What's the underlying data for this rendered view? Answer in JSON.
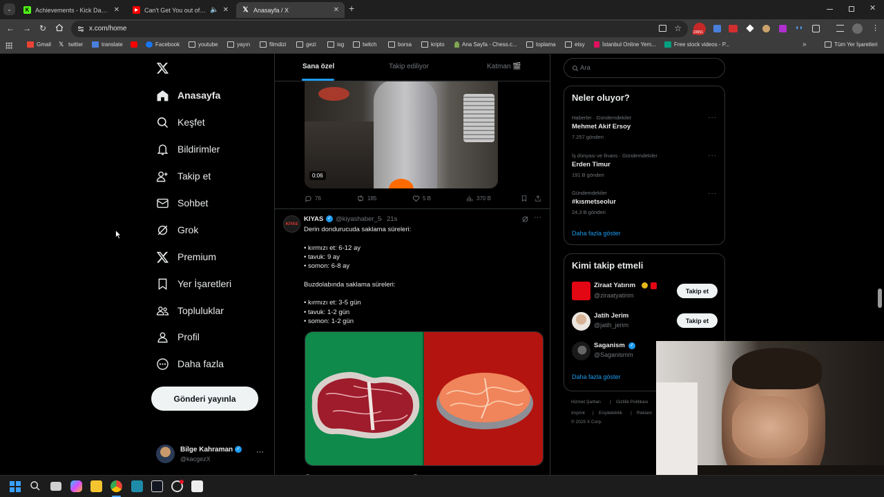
{
  "browser": {
    "tabs": [
      {
        "title": "Achievements - Kick Dashboard",
        "icon": "kick-icon",
        "color": "#53fc18"
      },
      {
        "title": "Can't Get You out of My He",
        "icon": "youtube-icon",
        "color": "#ff0000"
      },
      {
        "title": "Anasayfa / X",
        "icon": "x-logo-icon",
        "color": "#ffffff"
      }
    ],
    "url": "x.com/home",
    "badge_count": "23951",
    "bookmarks": [
      "Gmail",
      "twitter",
      "translate",
      "Facebook",
      "youtube",
      "yayın",
      "filmdizi",
      "gezi",
      "isg",
      "twitch",
      "borsa",
      "kripto",
      "Ana Sayfa - Chess.c...",
      "toplama",
      "etsy",
      "İstanbul Online Yem...",
      "Free stock videos - P..."
    ],
    "all_bookmarks": "Tüm Yer İşaretleri"
  },
  "nav": {
    "items": [
      "Anasayfa",
      "Keşfet",
      "Bildirimler",
      "Takip et",
      "Sohbet",
      "Grok",
      "Premium",
      "Yer İşaretleri",
      "Topluluklar",
      "Profil",
      "Daha fazla"
    ],
    "post_button": "Gönderi yayınla",
    "account": {
      "name": "Bilge Kahraman",
      "handle": "@kacgezX"
    }
  },
  "timeline": {
    "tabs": [
      "Sana özel",
      "Takip ediliyor",
      "Katman 🎬"
    ],
    "video_post": {
      "duration": "0:06",
      "replies": "76",
      "reposts": "185",
      "likes": "5 B",
      "views": "370 B"
    },
    "tweet": {
      "author": "KIYAS",
      "avatar_text": "KIYAS",
      "handle": "@kiyashaber_5",
      "time": "21s",
      "lines": [
        "Derin dondurucuda saklama süreleri:",
        "",
        "• kırmızı et: 6-12 ay",
        "• tavuk: 9 ay",
        "• somon: 6-8 ay",
        "",
        "Buzdolabında saklama süreleri:",
        "",
        "• kırmızı et: 3-5 gün",
        "• tavuk: 1-2 gün",
        "• somon: 1-2 gün"
      ]
    }
  },
  "sidebar": {
    "search_placeholder": "Ara",
    "trends_title": "Neler oluyor?",
    "trends": [
      {
        "meta": "Haberler · Gündemdekiler",
        "name": "Mehmet Akif Ersoy",
        "count": "7.257 gönderi"
      },
      {
        "meta": "İş dünyası ve finans · Gündemdekiler",
        "name": "Erden Timur",
        "count": "191 B gönderi"
      },
      {
        "meta": "Gündemdekiler",
        "name": "#kısmetseolur",
        "count": "24,3 B gönderi"
      }
    ],
    "show_more": "Daha fazla göster",
    "who_to_follow_title": "Kimi takip etmeli",
    "suggestions": [
      {
        "name": "Ziraat Yatırım",
        "handle": "@ziraatyatirim",
        "button": "Takip et"
      },
      {
        "name": "Jatih Jerim",
        "handle": "@jatih_jerim",
        "button": "Takip et"
      },
      {
        "name": "Saganism",
        "handle": "@Saganismm",
        "button": ""
      }
    ],
    "who_show_more": "Daha fazla göster",
    "footer": [
      "Hizmet Şartları",
      "Gizlilik Politikası",
      "Imprint",
      "Erişilebilirlik",
      "Reklam",
      "© 2025 X Corp."
    ]
  }
}
